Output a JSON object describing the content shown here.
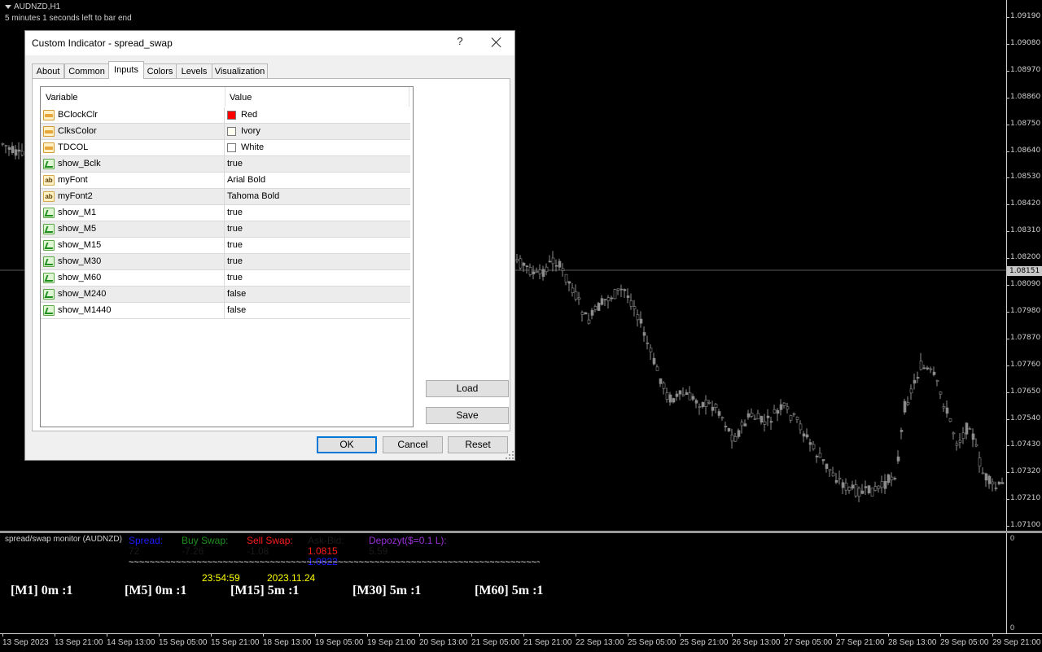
{
  "chart": {
    "symbol": "AUDNZD,H1",
    "bar_end_text": "5 minutes 1 seconds left to bar end",
    "current_price": "1.08151",
    "price_levels": [
      "1.09190",
      "1.09080",
      "1.08970",
      "1.08860",
      "1.08750",
      "1.08640",
      "1.08530",
      "1.08420",
      "1.08310",
      "1.08200",
      "1.08090",
      "1.07980",
      "1.07870",
      "1.07760",
      "1.07650",
      "1.07540",
      "1.07430",
      "1.07320",
      "1.07210",
      "1.07100"
    ],
    "time_labels": [
      "13 Sep 2023",
      "13 Sep 21:00",
      "14 Sep 13:00",
      "15 Sep 05:00",
      "15 Sep 21:00",
      "18 Sep 13:00",
      "19 Sep 05:00",
      "19 Sep 21:00",
      "20 Sep 13:00",
      "21 Sep 05:00",
      "21 Sep 21:00",
      "22 Sep 13:00",
      "25 Sep 05:00",
      "25 Sep 21:00",
      "26 Sep 13:00",
      "27 Sep 05:00",
      "27 Sep 21:00",
      "28 Sep 13:00",
      "29 Sep 05:00",
      "29 Sep 21:00"
    ],
    "colors": {
      "background": "#000000",
      "candles": "#8c8c8c",
      "axis_text": "#cfcfcf"
    }
  },
  "indicator": {
    "name": "spread/swap monitor (AUDNZD)",
    "scale_top": "0",
    "scale_bottom": "0",
    "spread_label": "Spread:",
    "spread_value": "72",
    "buy_swap_label": "Buy Swap:",
    "buy_swap_value": "-7.26",
    "sell_swap_label": "Sell Swap:",
    "sell_swap_value": "-1.08",
    "ask_bid_label": "Ask-Bid:",
    "ask_value": "1.0815",
    "bid_value": "1.0822",
    "deposit_label": "Depozyt($=0.1 L):",
    "deposit_value": "5.59",
    "separator": "~~~~~~~~~~~~~~~~~~~~~~~~~~~~~~~~~~~~~~~~~~~~~~~~~~~~~~~~~~~~~~~~~~~~~~~~~~~~~~~",
    "time": "23:54:59",
    "date": "2023.11.24",
    "timeframes": [
      "[M1] 0m :1",
      "[M5] 0m :1",
      "[M15] 5m :1",
      "[M30] 5m :1",
      "[M60] 5m :1"
    ],
    "colors": {
      "spread": "#1c1cff",
      "buy_swap": "#1f8f1f",
      "sell_swap": "#ff1c1c",
      "ask": "#ff1c1c",
      "bid": "#1c1cff",
      "deposit": "#9b30d9",
      "time": "#ffff00",
      "timeframes": "#ffffff"
    }
  },
  "dialog": {
    "title": "Custom Indicator - spread_swap",
    "help": "?",
    "tabs": [
      "About",
      "Common",
      "Inputs",
      "Colors",
      "Levels",
      "Visualization"
    ],
    "active_tab": "Inputs",
    "columns": {
      "variable": "Variable",
      "value": "Value"
    },
    "rows": [
      {
        "variable": "BClockClr",
        "value": "Red",
        "icon": "color-icon",
        "swatch": "#ff0000"
      },
      {
        "variable": "ClksColor",
        "value": "Ivory",
        "icon": "color-icon",
        "swatch": "#fffff0"
      },
      {
        "variable": "TDCOL",
        "value": "White",
        "icon": "color-icon",
        "swatch": "#ffffff"
      },
      {
        "variable": "show_Bclk",
        "value": "true",
        "icon": "bool-icon"
      },
      {
        "variable": "myFont",
        "value": "Arial Bold",
        "icon": "string-icon"
      },
      {
        "variable": "myFont2",
        "value": "Tahoma Bold",
        "icon": "string-icon"
      },
      {
        "variable": "show_M1",
        "value": "true",
        "icon": "bool-icon"
      },
      {
        "variable": "show_M5",
        "value": "true",
        "icon": "bool-icon"
      },
      {
        "variable": "show_M15",
        "value": "true",
        "icon": "bool-icon"
      },
      {
        "variable": "show_M30",
        "value": "true",
        "icon": "bool-icon"
      },
      {
        "variable": "show_M60",
        "value": "true",
        "icon": "bool-icon"
      },
      {
        "variable": "show_M240",
        "value": "false",
        "icon": "bool-icon"
      },
      {
        "variable": "show_M1440",
        "value": "false",
        "icon": "bool-icon"
      }
    ],
    "string_icon_text": "ab",
    "load_label": "Load",
    "save_label": "Save",
    "ok_label": "OK",
    "cancel_label": "Cancel",
    "reset_label": "Reset"
  }
}
